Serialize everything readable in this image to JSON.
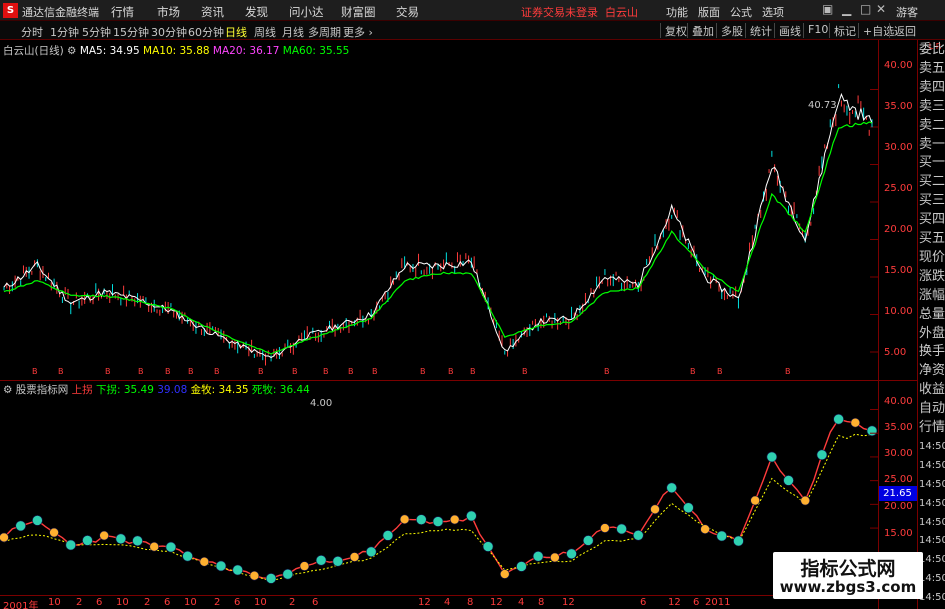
{
  "titlebar": {
    "logo": "S",
    "app_title": "通达信金融终端",
    "menu": [
      "行情",
      "市场",
      "资讯",
      "发现",
      "问小达",
      "财富圈",
      "交易"
    ],
    "notice": "证券交易未登录",
    "stock": "白云山",
    "right_menu": [
      "功能",
      "版面",
      "公式",
      "选项"
    ],
    "guest": "游客"
  },
  "period_tabs": [
    "分时",
    "1分钟",
    "5分钟",
    "15分钟",
    "30分钟",
    "60分钟",
    "日线",
    "周线",
    "月线",
    "多周期",
    "更多"
  ],
  "active_period": "日线",
  "toolbar": [
    "复权",
    "叠加",
    "多股",
    "统计",
    "画线",
    "F10",
    "标记",
    "+自选",
    "返回"
  ],
  "r_tag": "L R",
  "main": {
    "title": "白云山(日线)",
    "ma": [
      {
        "label": "MA5: 34.95",
        "color": "#ffffff"
      },
      {
        "label": "MA10: 35.88",
        "color": "#ffff00"
      },
      {
        "label": "MA20: 36.17",
        "color": "#ff44ff"
      },
      {
        "label": "MA60: 35.55",
        "color": "#00ff00"
      }
    ],
    "high_label": "40.73",
    "low_label": "4.00",
    "y_ticks": [
      "40.00",
      "35.00",
      "30.00",
      "25.00",
      "20.00",
      "15.00",
      "10.00",
      "5.00"
    ]
  },
  "sub": {
    "title": "股票指标网",
    "items": [
      {
        "label": "上拐",
        "color": "#ff3c3c"
      },
      {
        "label": "下拐: 35.49",
        "color": "#00ff00"
      },
      {
        "label": "39.08",
        "color": "#3030ff"
      },
      {
        "label": "金牧: 34.35",
        "color": "#ffff00"
      },
      {
        "label": "死牧: 36.44",
        "color": "#00ff00"
      }
    ],
    "y_ticks": [
      "40.00",
      "35.00",
      "30.00",
      "25.00",
      "20.00",
      "15.00"
    ],
    "badge": "21.65"
  },
  "x_axis": [
    "2001年",
    "10",
    "2",
    "6",
    "10",
    "2",
    "6",
    "10",
    "2",
    "6",
    "10",
    "2",
    "6",
    "12",
    "4",
    "8",
    "12",
    "4",
    "8",
    "12",
    "6",
    "12",
    "6",
    "2011"
  ],
  "side": [
    "委比",
    "卖五",
    "卖四",
    "卖三",
    "卖二",
    "卖一",
    "买一",
    "买二",
    "买三",
    "买四",
    "买五",
    "现价",
    "涨跌",
    "涨幅",
    "总量",
    "外盘",
    "换手",
    "净资",
    "收益",
    "自动",
    "行情",
    "14:50",
    "14:50",
    "14:50",
    "14:50",
    "14:50",
    "14:50",
    "14:50",
    "14:50",
    "14:50"
  ],
  "watermark": {
    "line1": "指标公式网",
    "line2": "www.zbgs3.com"
  },
  "chart_data": {
    "type": "line",
    "title": "白云山(日线)",
    "ylim": [
      3,
      43
    ],
    "series": [
      {
        "name": "MA5",
        "values": [
          13.5,
          16.5,
          11.5,
          13.0,
          12.0,
          10.5,
          8.0,
          6.0,
          4.2,
          7.0,
          8.5,
          10.0,
          16.5,
          16.5,
          17.0,
          5.0,
          9.0,
          9.5,
          15.0,
          14.0,
          24.0,
          15.0,
          12.0,
          30.0,
          20.0,
          39.0,
          35.5
        ]
      },
      {
        "name": "MA60",
        "values": [
          13.0,
          14.5,
          12.5,
          12.5,
          11.8,
          10.8,
          8.5,
          6.5,
          4.8,
          6.5,
          8.0,
          9.5,
          14.5,
          15.5,
          15.5,
          7.0,
          8.5,
          9.0,
          13.0,
          13.5,
          21.0,
          16.0,
          13.0,
          26.0,
          21.0,
          35.0,
          35.55
        ]
      }
    ],
    "markers": {
      "high": 40.73,
      "low": 4.0
    }
  }
}
